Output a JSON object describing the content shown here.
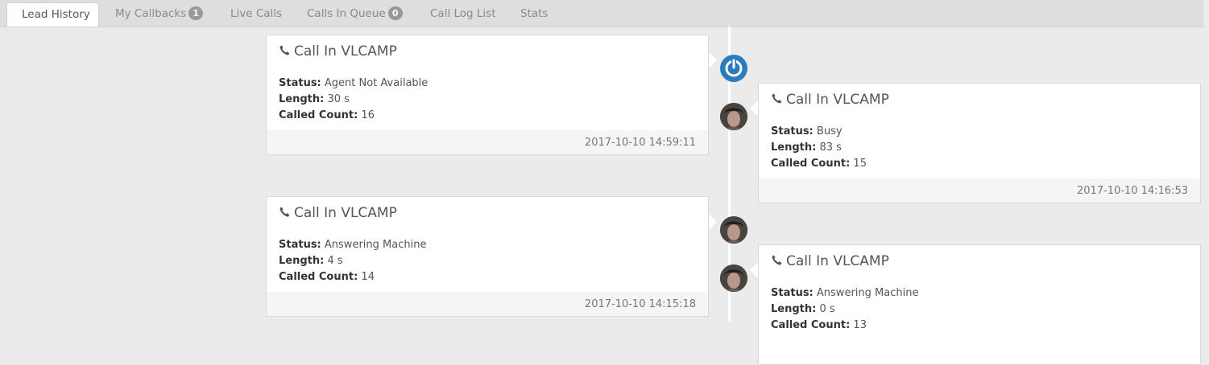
{
  "tabs": [
    {
      "label": "Lead History",
      "badge": null,
      "active": true
    },
    {
      "label": "My Callbacks",
      "badge": "1",
      "active": false
    },
    {
      "label": "Live Calls",
      "badge": null,
      "active": false
    },
    {
      "label": "Calls In Queue",
      "badge": "0",
      "active": false
    },
    {
      "label": "Call Log List",
      "badge": null,
      "active": false
    },
    {
      "label": "Stats",
      "badge": null,
      "active": false
    }
  ],
  "labels": {
    "status": "Status:",
    "length": "Length:",
    "called_count": "Called Count:"
  },
  "entries": [
    {
      "title": "Call In VLCAMP",
      "status": "Agent Not Available",
      "length": "30 s",
      "called_count": "16",
      "timestamp": "2017-10-10 14:59:11",
      "side": "left",
      "icon": "power-icon"
    },
    {
      "title": "Call In VLCAMP",
      "status": "Busy",
      "length": "83 s",
      "called_count": "15",
      "timestamp": "2017-10-10 14:16:53",
      "side": "right",
      "icon": "avatar"
    },
    {
      "title": "Call In VLCAMP",
      "status": "Answering Machine",
      "length": "4 s",
      "called_count": "14",
      "timestamp": "2017-10-10 14:15:18",
      "side": "left",
      "icon": "avatar"
    },
    {
      "title": "Call In VLCAMP",
      "status": "Answering Machine",
      "length": "0 s",
      "called_count": "13",
      "timestamp": "",
      "side": "right",
      "icon": "avatar"
    }
  ],
  "colors": {
    "background": "#ebebeb",
    "tabbar": "#dedede",
    "badge": "#999999",
    "system_icon": "#2b7bc0"
  }
}
